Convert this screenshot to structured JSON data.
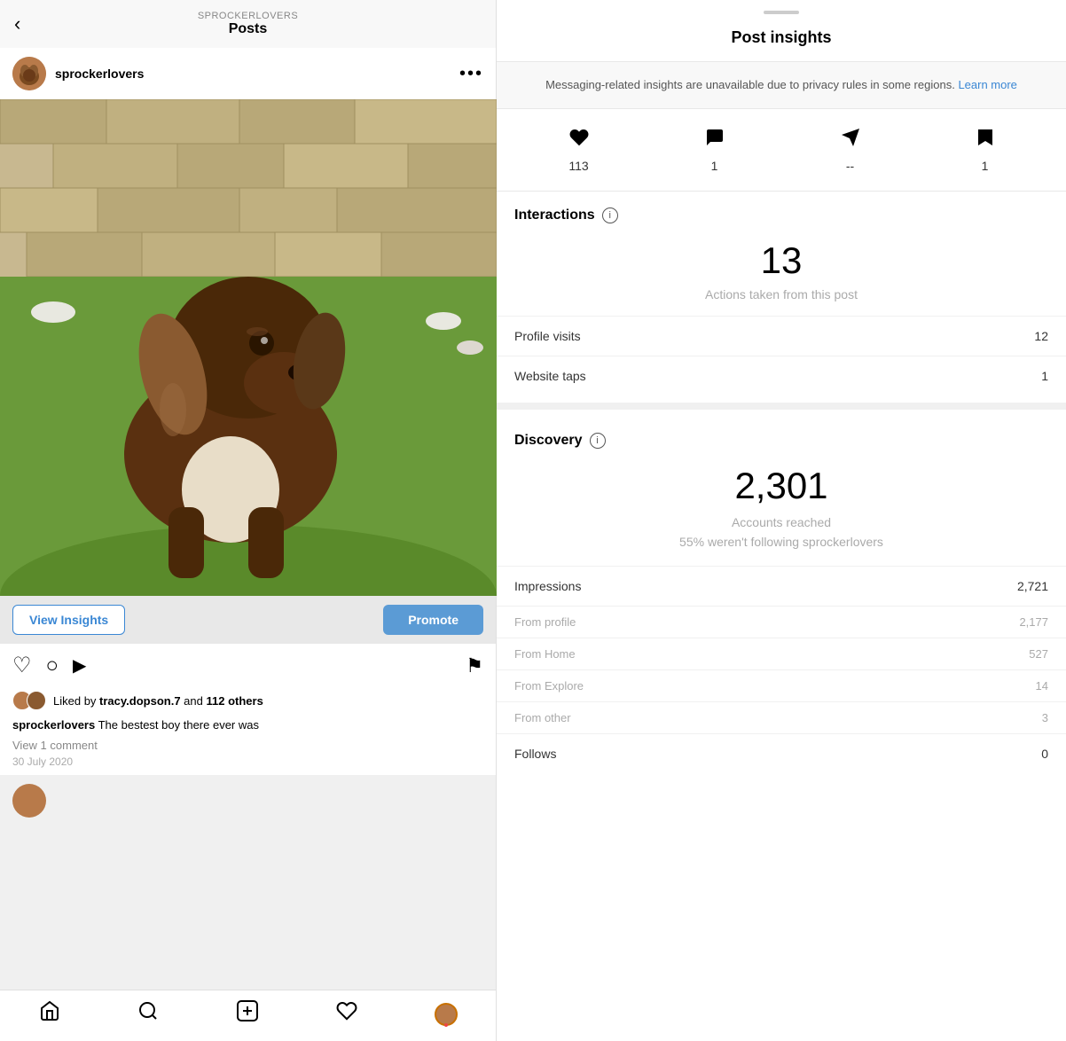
{
  "left": {
    "top_bar": {
      "back_label": "‹",
      "account_name": "SPROCKERLOVERS",
      "title": "Posts"
    },
    "post_header": {
      "username": "sprockerlovers",
      "more_icon": "•••"
    },
    "view_insights_label": "View Insights",
    "promote_label": "Promote",
    "likes_text_prefix": "Liked by ",
    "likes_user": "tracy.dopson.7",
    "likes_suffix": " and ",
    "likes_others": "112 others",
    "caption_username": "sprockerlovers",
    "caption": " The bestest boy there ever was",
    "view_comments": "View 1 comment",
    "post_date": "30 July 2020",
    "nav": {
      "home": "⌂",
      "search": "○",
      "add": "⊞",
      "heart": "♡"
    }
  },
  "right": {
    "drag_handle": true,
    "title": "Post insights",
    "privacy_notice": "Messaging-related insights are unavailable due to privacy rules in some regions.",
    "learn_more": "Learn more",
    "metrics": [
      {
        "icon": "heart",
        "value": "113"
      },
      {
        "icon": "comment",
        "value": "1"
      },
      {
        "icon": "send",
        "value": "--"
      },
      {
        "icon": "bookmark",
        "value": "1"
      }
    ],
    "interactions_title": "Interactions",
    "interactions_number": "13",
    "interactions_label": "Actions taken from this post",
    "profile_visits_label": "Profile visits",
    "profile_visits_value": "12",
    "website_taps_label": "Website taps",
    "website_taps_value": "1",
    "discovery_title": "Discovery",
    "accounts_reached": "2,301",
    "accounts_reached_label": "Accounts reached",
    "accounts_reached_sublabel": "55% weren't following sprockerlovers",
    "impressions_label": "Impressions",
    "impressions_value": "2,721",
    "from_profile_label": "From profile",
    "from_profile_value": "2,177",
    "from_home_label": "From Home",
    "from_home_value": "527",
    "from_explore_label": "From Explore",
    "from_explore_value": "14",
    "from_other_label": "From other",
    "from_other_value": "3",
    "follows_label": "Follows",
    "follows_value": "0"
  }
}
